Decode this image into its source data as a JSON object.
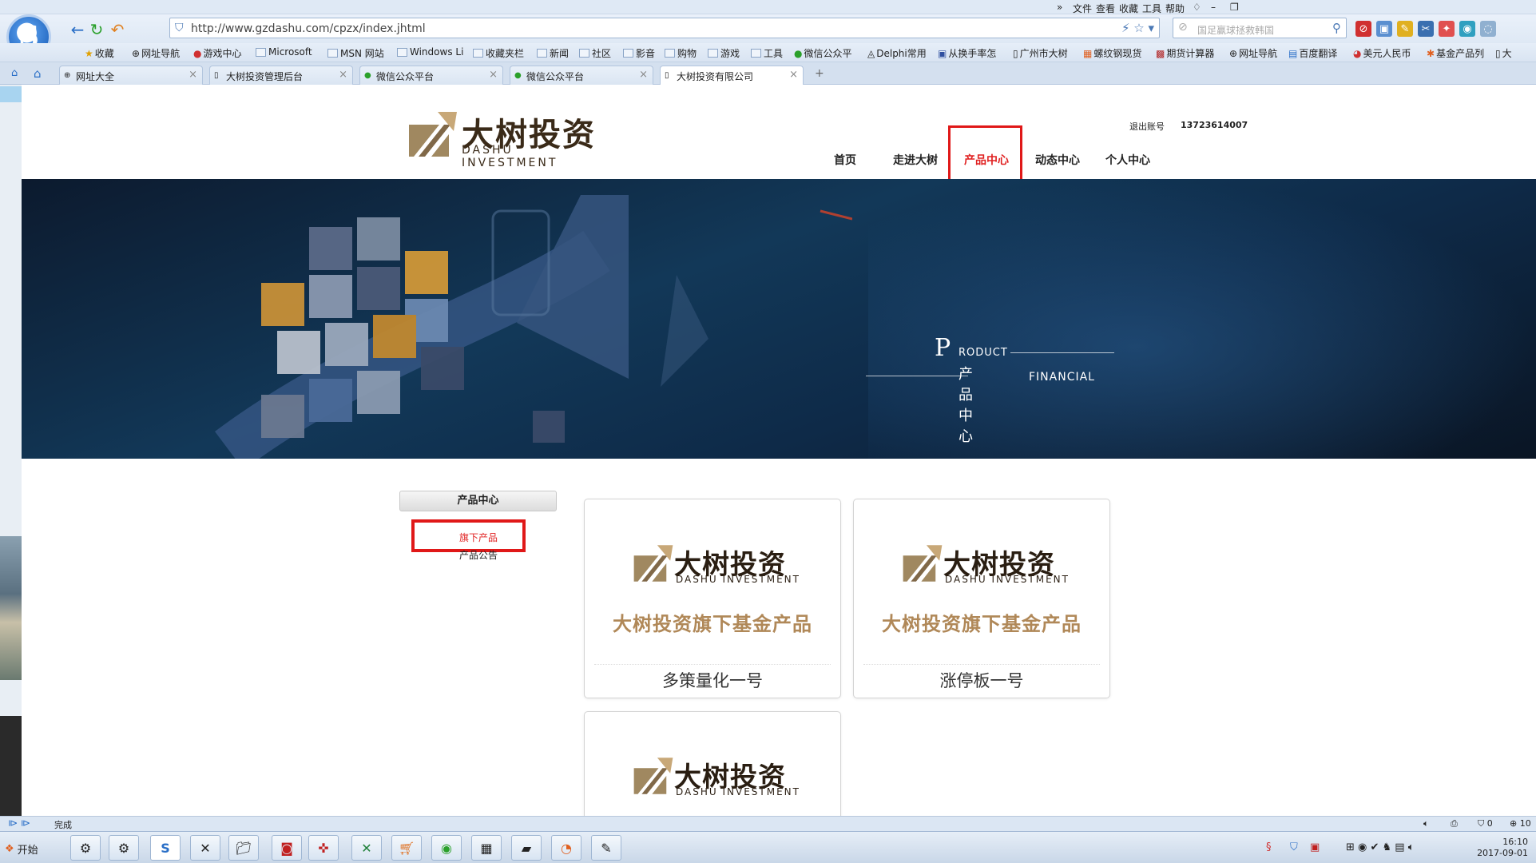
{
  "browser": {
    "menu": [
      "文件",
      "查看",
      "收藏",
      "工具",
      "帮助"
    ],
    "url": "http://www.gzdashu.com/cpzx/index.jhtml",
    "search_placeholder": "国足赢球拯救韩国",
    "bookmarks": [
      "收藏",
      "网址导航",
      "游戏中心",
      "Microsoft",
      "MSN 网站",
      "Windows Li",
      "收藏夹栏",
      "新闻",
      "社区",
      "影音",
      "购物",
      "游戏",
      "工具",
      "微信公众平",
      "Delphi常用",
      "从换手率怎",
      "广州市大树",
      "螺纹钢现货",
      "期货计算器",
      "网址导航",
      "百度翻译",
      "美元人民币",
      "基金产品列",
      "大"
    ],
    "tabs": [
      "网址大全",
      "大树投资管理后台",
      "微信公众平台",
      "微信公众平台",
      "大树投资有限公司"
    ],
    "status": "完成",
    "zoom_status": "10",
    "taskbar_start": "开始",
    "clock_time": "16:10",
    "clock_date": "2017-09-01"
  },
  "site": {
    "logo_cn": "大树投资",
    "logo_en": "DASHU INVESTMENT",
    "account_label": "退出账号",
    "account_phone": "13723614007",
    "nav": [
      "首页",
      "走进大树",
      "产品中心",
      "动态中心",
      "个人中心"
    ],
    "banner": {
      "p": "P",
      "product": "RODUCT",
      "cn": "产品中心",
      "financial": "FINANCIAL"
    },
    "sidebar": {
      "title": "产品中心",
      "items": [
        "旗下产品",
        "产品公告"
      ]
    },
    "products": [
      {
        "desc": "大树投资旗下基金产品",
        "name": "多策量化一号"
      },
      {
        "desc": "大树投资旗下基金产品",
        "name": "涨停板一号"
      },
      {
        "desc": "",
        "name": ""
      }
    ]
  }
}
